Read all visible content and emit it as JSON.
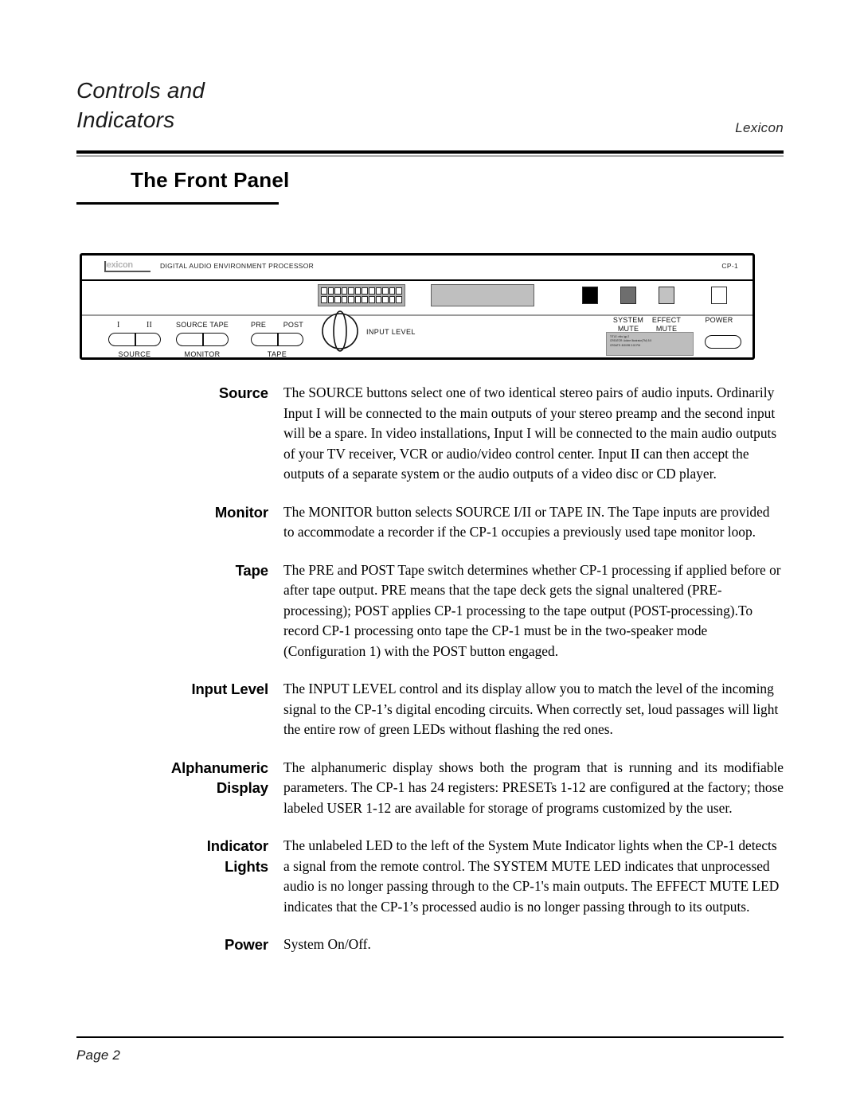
{
  "header": {
    "chapter_title": "Controls and\nIndicators",
    "brand": "Lexicon"
  },
  "section": {
    "title": "The Front Panel"
  },
  "panel": {
    "logo_text": "lexicon",
    "subtitle": "DIGITAL AUDIO ENVIRONMENT PROCESSOR",
    "model": "CP-1",
    "input_level_label": "INPUT LEVEL",
    "led_segments_per_row": 12,
    "led_rows": 2,
    "buttons": [
      {
        "name": "source",
        "left_label": "I",
        "right_label": "II",
        "group_label": "SOURCE"
      },
      {
        "name": "monitor",
        "left_label": "SOURCE",
        "right_label": "TAPE",
        "group_label": "MONITOR"
      },
      {
        "name": "tape",
        "left_label": "PRE",
        "right_label": "POST",
        "group_label": "TAPE"
      }
    ],
    "indicators": [
      {
        "name": "remote-led",
        "caption": "",
        "color": "#000000"
      },
      {
        "name": "system-mute-led",
        "caption": "SYSTEM\nMUTE",
        "color": "#6e6e6e"
      },
      {
        "name": "effect-mute-led",
        "caption": "EFFECT\nMUTE",
        "color": "#c2c2c2"
      },
      {
        "name": "power-led",
        "caption": "POWER",
        "color": "#ffffff"
      }
    ],
    "captions": {
      "system_mute": "SYSTEM\nMUTE",
      "effect_mute": "EFFECT\nMUTE",
      "power": "POWER"
    },
    "eps_stamp": "TITLE: elks /gp 2\nCREATOR: Adobe Illustrator(TM) 5.5\nCRDATE: 8/30/95 3:02 PM"
  },
  "definitions": [
    {
      "term": "Source",
      "desc": "The SOURCE buttons select one of two identical stereo pairs of audio inputs.  Ordinarily Input I will be connected to the main outputs of your stereo preamp and the second input will be a spare.  In video installations, Input I will be connected to the main audio outputs of your TV receiver, VCR or audio/video control center.  Input II can then accept the outputs of a separate system or the audio outputs of a video disc or CD player."
    },
    {
      "term": "Monitor",
      "desc": "The MONITOR  button selects SOURCE I/II or TAPE IN. The Tape inputs are provided to accommodate a recorder if the CP-1 occupies a previously used tape monitor loop."
    },
    {
      "term": "Tape",
      "desc": "The PRE and POST Tape switch determines whether CP-1 processing if applied before or after tape output. PRE means that the tape deck gets the signal unaltered (PRE-processing); POST applies CP-1 processing to the tape output (POST-processing).To record  CP-1 processing onto tape the CP-1 must be in the two-speaker mode (Configuration 1) with the POST button engaged."
    },
    {
      "term": "Input Level",
      "desc": "The INPUT LEVEL control and its display allow you to match the level of the incoming signal to the CP-1’s digital encoding circuits.  When correctly set, loud passages will light the entire row of green LEDs without flashing the red ones."
    },
    {
      "term": "Alphanumeric\nDisplay",
      "desc": "The alphanumeric display shows both the program that is running and its modifiable  parameters.   The  CP-1  has  24  registers:  PRESETs  1-12  are configured at the factory; those labeled USER 1-12 are available for storage of programs customized by the user."
    },
    {
      "term": "Indicator\nLights",
      "desc": "The unlabeled  LED to the left of the System Mute Indicator lights when the CP-1 detects a signal from the remote control.  The SYSTEM MUTE LED indicates that unprocessed audio is no longer passing through to the CP-1's main outputs. The EFFECT MUTE LED indicates that the CP-1’s processed audio is no longer passing through to its outputs."
    },
    {
      "term": "Power",
      "desc": "System On/Off."
    }
  ],
  "footer": {
    "page_label": "Page 2"
  }
}
